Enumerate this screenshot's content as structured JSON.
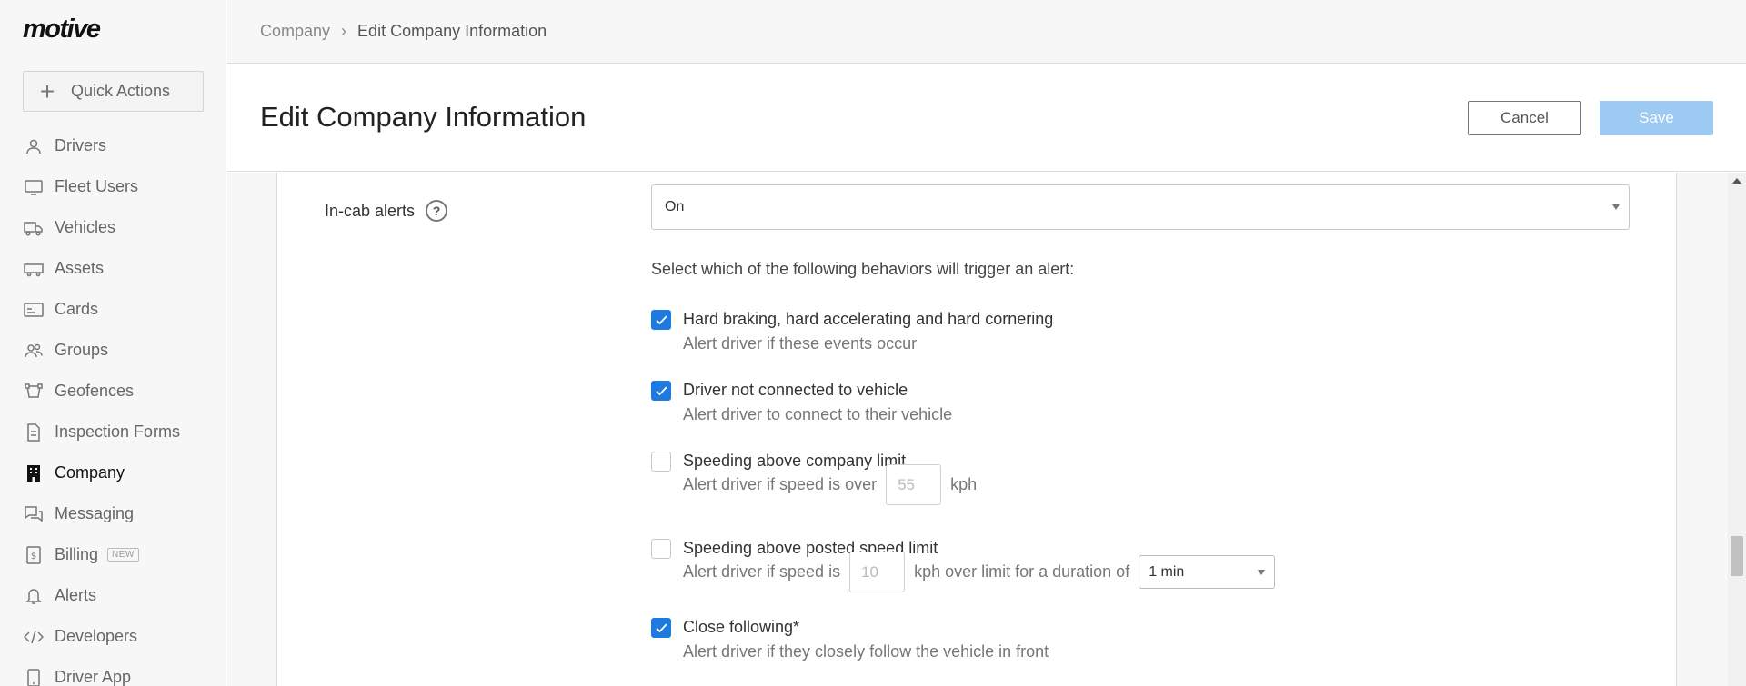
{
  "app": {
    "logo": "motive"
  },
  "sidebar": {
    "quick_actions": "Quick Actions",
    "items": [
      {
        "label": "Drivers",
        "icon": "user-icon"
      },
      {
        "label": "Fleet Users",
        "icon": "monitor-icon"
      },
      {
        "label": "Vehicles",
        "icon": "truck-icon"
      },
      {
        "label": "Assets",
        "icon": "trailer-icon"
      },
      {
        "label": "Cards",
        "icon": "card-icon"
      },
      {
        "label": "Groups",
        "icon": "group-icon"
      },
      {
        "label": "Geofences",
        "icon": "geofence-icon"
      },
      {
        "label": "Inspection Forms",
        "icon": "document-icon"
      },
      {
        "label": "Company",
        "icon": "building-icon",
        "active": true
      },
      {
        "label": "Messaging",
        "icon": "chat-icon"
      },
      {
        "label": "Billing",
        "icon": "dollar-icon",
        "badge": "NEW"
      },
      {
        "label": "Alerts",
        "icon": "bell-icon"
      },
      {
        "label": "Developers",
        "icon": "code-icon"
      },
      {
        "label": "Driver App",
        "icon": "phone-icon"
      }
    ]
  },
  "breadcrumb": {
    "parent": "Company",
    "separator": "›",
    "current": "Edit Company Information"
  },
  "header": {
    "title": "Edit Company Information",
    "cancel": "Cancel",
    "save": "Save"
  },
  "form": {
    "incab_label": "In-cab alerts",
    "help": "?",
    "incab_value": "On",
    "instructions": "Select which of the following behaviors will trigger an alert:",
    "options": [
      {
        "title": "Hard braking, hard accelerating and hard cornering",
        "desc": "Alert driver if these events occur",
        "checked": true
      },
      {
        "title": "Driver not connected to vehicle",
        "desc": "Alert driver to connect to their vehicle",
        "checked": true
      },
      {
        "title": "Speeding above company limit",
        "desc_prefix": "Alert driver if speed is over",
        "input_placeholder": "55",
        "desc_suffix": "kph",
        "checked": false
      },
      {
        "title": "Speeding above posted speed limit",
        "desc_prefix": "Alert driver if speed is",
        "input_placeholder": "10",
        "desc_suffix": "kph over limit for a duration of",
        "duration": "1 min",
        "checked": false
      },
      {
        "title": "Close following*",
        "desc": "Alert driver if they closely follow the vehicle in front",
        "checked": true
      }
    ]
  },
  "colors": {
    "accent": "#1f7ae0",
    "save_disabled": "#9ccaf3"
  }
}
